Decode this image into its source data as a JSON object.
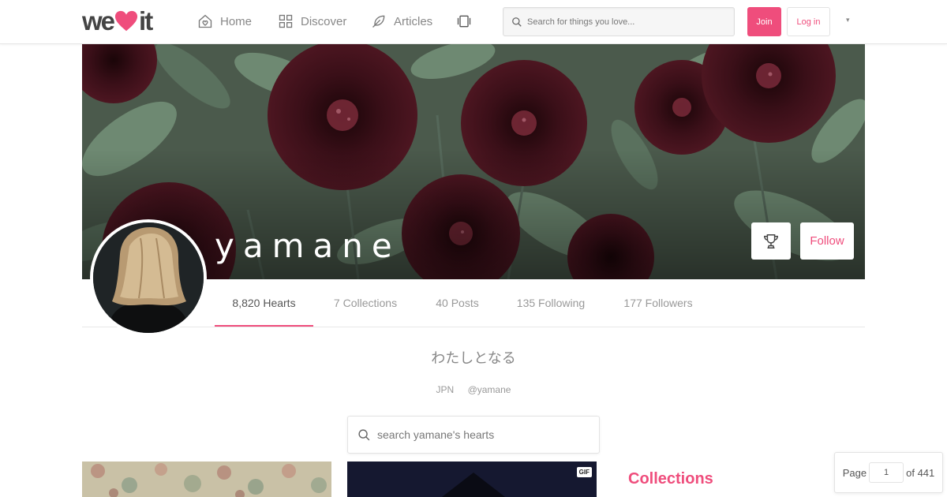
{
  "nav": {
    "logo_text_start": "we",
    "logo_text_end": "it",
    "home": "Home",
    "discover": "Discover",
    "articles": "Articles",
    "search_placeholder": "Search for things you love...",
    "join": "Join",
    "login": "Log in",
    "menu_caret": "▾"
  },
  "profile": {
    "username": "yamane",
    "follow": "Follow",
    "bio": "わたしとなる",
    "country": "JPN",
    "handle": "@yamane"
  },
  "tabs": [
    {
      "label": "8,820 Hearts",
      "active": true
    },
    {
      "label": "7 Collections"
    },
    {
      "label": "40 Posts"
    },
    {
      "label": "135 Following"
    },
    {
      "label": "177 Followers"
    }
  ],
  "hearts_search_placeholder": "search yamane's hearts",
  "gif_badge": "GIF",
  "collections_title": "Collections",
  "pagination": {
    "label": "Page",
    "current": "1",
    "total_text": "of 441"
  },
  "colors": {
    "accent": "#ef4d7c",
    "cover_flower": "#3a1018",
    "cover_leaf": "#6f8a72"
  },
  "icons": {
    "home": "home-icon",
    "discover": "grid-icon",
    "articles": "feather-icon",
    "cards": "cards-icon",
    "search": "search-icon",
    "trophy": "trophy-icon"
  }
}
